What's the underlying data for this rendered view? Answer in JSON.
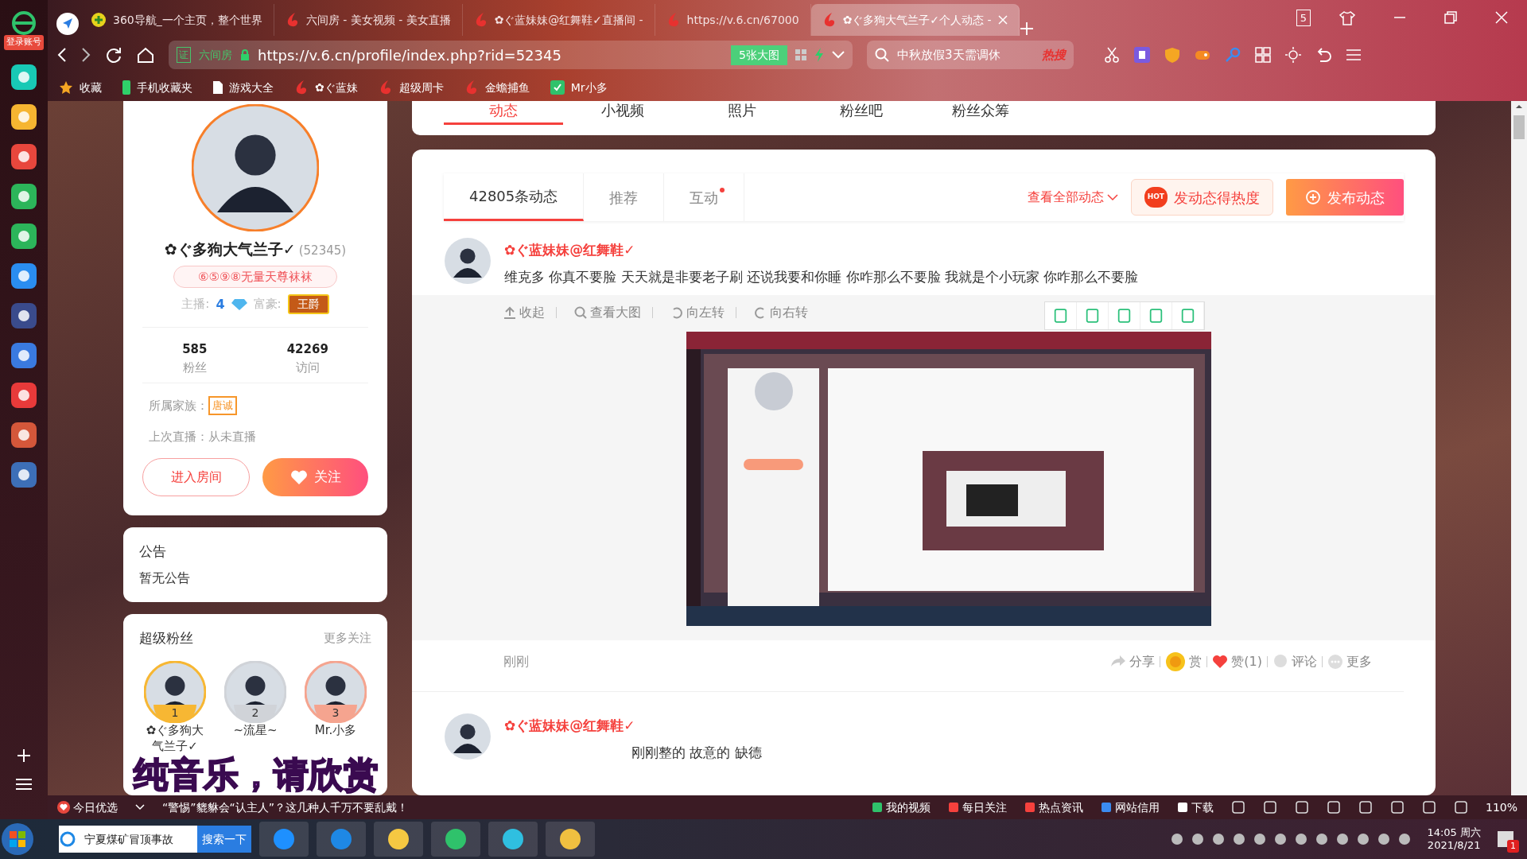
{
  "sidebar": {
    "login": "登录账号"
  },
  "tabs": [
    {
      "label": "360导航_一个主页，整个世界",
      "selected": false,
      "kind": "nav"
    },
    {
      "label": "六间房 - 美女视频 - 美女直播",
      "selected": false,
      "kind": "six"
    },
    {
      "label": "✿ぐ蓝妹妹@红舞鞋✓直播间 -",
      "selected": false,
      "kind": "six"
    },
    {
      "label": "https://v.6.cn/67000",
      "selected": false,
      "kind": "six"
    },
    {
      "label": "✿ぐ多狗大气兰子✓个人动态 -",
      "selected": true,
      "kind": "six"
    }
  ],
  "tab_count": "5",
  "address_bar": {
    "cert": "证",
    "site": "六间房",
    "url": "https://v.6.cn/profile/index.php?rid=52345",
    "images": "5张大图",
    "search": "中秋放假3天需调休",
    "hot": "热搜"
  },
  "bookmarks": [
    {
      "label": "收藏",
      "kind": "star"
    },
    {
      "label": "手机收藏夹",
      "kind": "phone"
    },
    {
      "label": "游戏大全",
      "kind": "doc"
    },
    {
      "label": "✿ぐ蓝妹",
      "kind": "six"
    },
    {
      "label": "超级周卡",
      "kind": "six"
    },
    {
      "label": "金蟾捕鱼",
      "kind": "six"
    },
    {
      "label": "Mr小多",
      "kind": "green"
    }
  ],
  "profile": {
    "name": "✿ぐ多狗大气兰子✓",
    "id": "(52345)",
    "title_badge": "⑥⑤⑨⑧无量天尊袜袜",
    "anchor_label": "主播:",
    "anchor_level": "4",
    "rich_label": "富豪:",
    "rich_rank": "王爵",
    "stats": [
      {
        "value": "585",
        "label": "粉丝"
      },
      {
        "value": "42269",
        "label": "访问"
      }
    ],
    "family_label": "所属家族：",
    "family": "唐诚",
    "last_live": "上次直播：从未直播",
    "enter_button": "进入房间",
    "follow_button": "关注"
  },
  "announcement": {
    "title": "公告",
    "text": "暂无公告"
  },
  "super_fans": {
    "title": "超级粉丝",
    "more": "更多关注",
    "fans": [
      {
        "rank": "1",
        "name": "✿ぐ多狗大气兰子✓",
        "color": "#f7b733"
      },
      {
        "rank": "2",
        "name": "~流星~",
        "color": "#d0d3d8"
      },
      {
        "rank": "3",
        "name": "Mr.小多",
        "color": "#f5a48f"
      }
    ]
  },
  "top_nav": [
    {
      "label": "动态",
      "selected": true
    },
    {
      "label": "小视频",
      "selected": false
    },
    {
      "label": "照片",
      "selected": false
    },
    {
      "label": "粉丝吧",
      "selected": false
    },
    {
      "label": "粉丝众筹",
      "selected": false
    }
  ],
  "feed_tabs": [
    {
      "label": "42805条动态",
      "selected": true,
      "dot": false
    },
    {
      "label": "推荐",
      "selected": false,
      "dot": false
    },
    {
      "label": "互动",
      "selected": false,
      "dot": true
    }
  ],
  "feed_actions": {
    "view_all": "查看全部动态",
    "hot_badge": "HOT",
    "heat": "发动态得热度",
    "publish": "发布动态"
  },
  "posts": [
    {
      "author": "✿ぐ蓝妹妹@红舞鞋✓",
      "text": "维克多 你真不要脸 天天就是非要老子刷 还说我要和你睡 你咋那么不要脸 我就是个小玩家 你咋那么不要脸",
      "image_tools": [
        "收起",
        "查看大图",
        "向左转",
        "向右转"
      ],
      "image": {
        "kind": "picture"
      },
      "time": "刚刚",
      "actions": [
        {
          "label": "分享",
          "kind": "share"
        },
        {
          "label": "赏",
          "kind": "reward"
        },
        {
          "label": "赞(1)",
          "kind": "like"
        },
        {
          "label": "评论",
          "kind": "comment"
        },
        {
          "label": "更多",
          "kind": "more"
        }
      ]
    },
    {
      "author": "✿ぐ蓝妹妹@红舞鞋✓",
      "text": "刚刚整的 故意的 缺德"
    }
  ],
  "lyrics": "纯音乐，请欣赏",
  "status_bar": {
    "left": "今日优选",
    "news": "“警惕”貔貅会“认主人”？这几种人千万不要乱戴！",
    "items": [
      "我的视频",
      "每日关注",
      "热点资讯",
      "网站信用",
      "下载"
    ],
    "zoom": "110%"
  },
  "taskbar": {
    "search": "宁夏煤矿冒顶事故",
    "search_button": "搜索一下",
    "time": "14:05 周六",
    "date": "2021/8/21",
    "notifications": "1"
  }
}
